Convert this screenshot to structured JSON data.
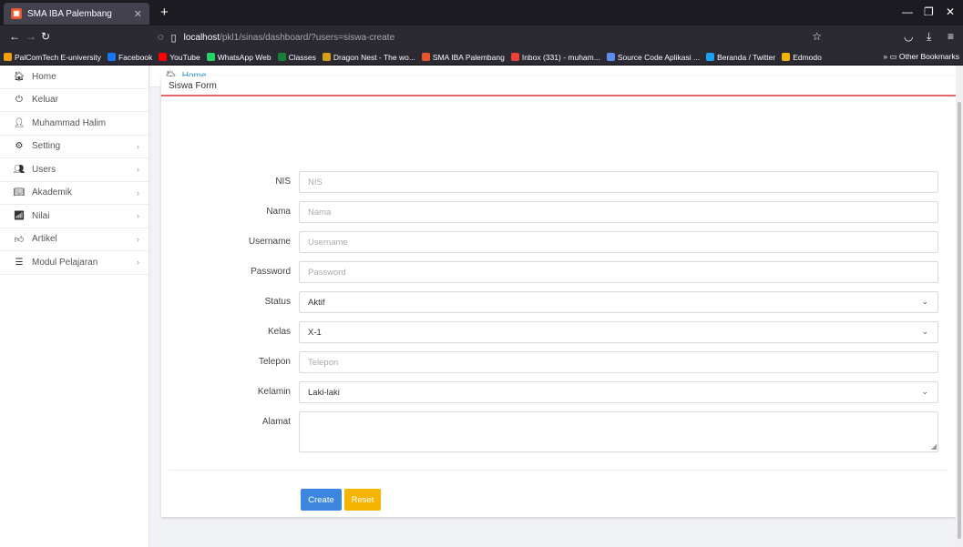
{
  "browser": {
    "tab_title": "SMA IBA Palembang",
    "url_host": "localhost",
    "url_path": "/pkl1/sinas/dashboard/?users=siswa-create",
    "bookmarks": [
      {
        "label": "PalComTech E-university",
        "color": "#f2a000"
      },
      {
        "label": "Facebook",
        "color": "#1877f2"
      },
      {
        "label": "YouTube",
        "color": "#ff0000"
      },
      {
        "label": "WhatsApp Web",
        "color": "#25d366"
      },
      {
        "label": "Classes",
        "color": "#188038"
      },
      {
        "label": "Dragon Nest - The wo...",
        "color": "#d4a017"
      },
      {
        "label": "SMA IBA Palembang",
        "color": "#e8552d"
      },
      {
        "label": "Inbox (331) - muham...",
        "color": "#ea4335"
      },
      {
        "label": "Source Code Aplikasi ...",
        "color": "#5a8dee"
      },
      {
        "label": "Beranda / Twitter",
        "color": "#1da1f2"
      },
      {
        "label": "Edmodo",
        "color": "#f4b400"
      }
    ],
    "other_bookmarks": "Other Bookmarks"
  },
  "sidebar": {
    "items": [
      {
        "label": "Home",
        "icon": "home-icon",
        "glyph": "🏠︎"
      },
      {
        "label": "Keluar",
        "icon": "power-icon",
        "glyph": "⏻"
      },
      {
        "label": "Muhammad Halim",
        "icon": "user-icon",
        "glyph": "👤︎"
      },
      {
        "label": "Setting",
        "icon": "gear-icon",
        "glyph": "⚙"
      },
      {
        "label": "Users",
        "icon": "users-icon",
        "glyph": "👥︎"
      },
      {
        "label": "Akademik",
        "icon": "book-icon",
        "glyph": "📖︎"
      },
      {
        "label": "Nilai",
        "icon": "bar-chart-icon",
        "glyph": "📶︎"
      },
      {
        "label": "Artikel",
        "icon": "thumbs-up-icon",
        "glyph": "👍︎"
      },
      {
        "label": "Modul Pelajaran",
        "icon": "list-icon",
        "glyph": "☰"
      }
    ]
  },
  "breadcrumb": {
    "label": "Home"
  },
  "card": {
    "title": "Siswa Form"
  },
  "form": {
    "nis": {
      "label": "NIS",
      "placeholder": "NIS"
    },
    "nama": {
      "label": "Nama",
      "placeholder": "Nama"
    },
    "username": {
      "label": "Username",
      "placeholder": "Username"
    },
    "password": {
      "label": "Password",
      "placeholder": "Password"
    },
    "status": {
      "label": "Status",
      "value": "Aktif"
    },
    "kelas": {
      "label": "Kelas",
      "value": "X-1"
    },
    "telepon": {
      "label": "Telepon",
      "placeholder": "Telepon"
    },
    "kelamin": {
      "label": "Kelamin",
      "value": "Laki-laki"
    },
    "alamat": {
      "label": "Alamat",
      "value": ""
    }
  },
  "buttons": {
    "create": "Create",
    "reset": "Reset"
  },
  "accent_bars": [
    "#ee7355",
    "#f4c542",
    "#41c0e8"
  ]
}
